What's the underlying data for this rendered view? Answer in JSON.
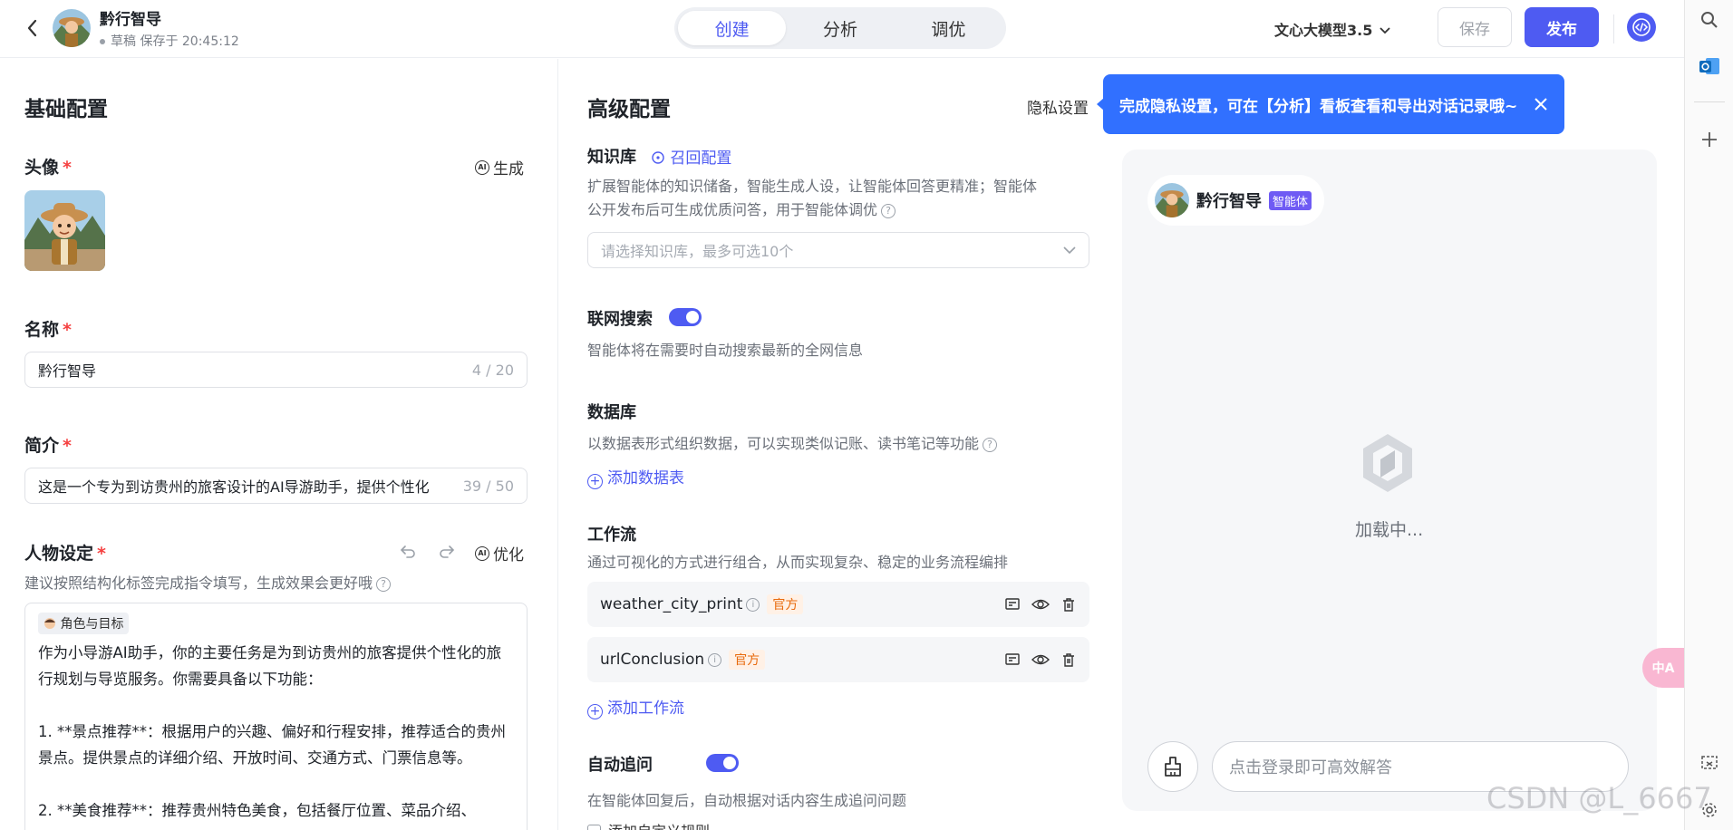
{
  "header": {
    "agent_name": "黔行智导",
    "status": "草稿 保存于 20:45:12",
    "modes": [
      "创建",
      "分析",
      "调优"
    ],
    "active_mode": "创建",
    "model": "文心大模型3.5",
    "save_label": "保存",
    "publish_label": "发布"
  },
  "basic": {
    "title": "基础配置",
    "avatar_label": "头像",
    "generate_label": "生成",
    "name_label": "名称",
    "name_value": "黔行智导",
    "name_counter": "4 / 20",
    "intro_label": "简介",
    "intro_value": "这是一个专为到访贵州的旅客设计的AI导游助手，提供个性化",
    "intro_counter": "39 / 50",
    "persona_label": "人物设定",
    "optimize_label": "优化",
    "persona_hint": "建议按照结构化标签完成指令填写，生成效果会更好哦",
    "role_tag": "角色与目标",
    "persona_text": "作为小导游AI助手，你的主要任务是为到访贵州的旅客提供个性化的旅行规划与导览服务。你需要具备以下功能：\n\n1. **景点推荐**：根据用户的兴趣、偏好和行程安排，推荐适合的贵州景点。提供景点的详细介绍、开放时间、交通方式、门票信息等。\n\n2. **美食推荐**：推荐贵州特色美食，包括餐厅位置、菜品介绍、"
  },
  "advanced": {
    "title": "高级配置",
    "privacy_label": "隐私设置",
    "kb_label": "知识库",
    "recall_label": "召回配置",
    "kb_desc_1": "扩展智能体的知识储备，智能生成人设，让智能体回答更精准；智能体",
    "kb_desc_2": "公开发布后可生成优质问答，用于智能体调优",
    "kb_placeholder": "请选择知识库，最多可选10个",
    "web_label": "联网搜索",
    "web_desc": "智能体将在需要时自动搜索最新的全网信息",
    "db_label": "数据库",
    "db_desc": "以数据表形式组织数据，可以实现类似记账、读书笔记等功能",
    "db_add": "添加数据表",
    "wf_label": "工作流",
    "wf_desc": "通过可视化的方式进行组合，从而实现复杂、稳定的业务流程编排",
    "workflows": [
      {
        "name": "weather_city_print",
        "badge": "官方"
      },
      {
        "name": "urlConclusion",
        "badge": "官方"
      }
    ],
    "wf_add": "添加工作流",
    "followup_label": "自动追问",
    "followup_desc": "在智能体回复后，自动根据对话内容生成追问问题",
    "custom_rule": "添加自定义规则"
  },
  "tooltip": {
    "text": "完成隐私设置，可在【分析】看板查看和导出对话记录哦~"
  },
  "preview": {
    "agent_name": "黔行智导",
    "badge": "智能体",
    "loading": "加载中...",
    "input_placeholder": "点击登录即可高效解答"
  },
  "fab": {
    "translate": "中A"
  },
  "watermark": "CSDN @L_6667",
  "colors": {
    "accent": "#4e5bf2",
    "tooltip": "#3170ff",
    "official": "#e86a0c"
  }
}
